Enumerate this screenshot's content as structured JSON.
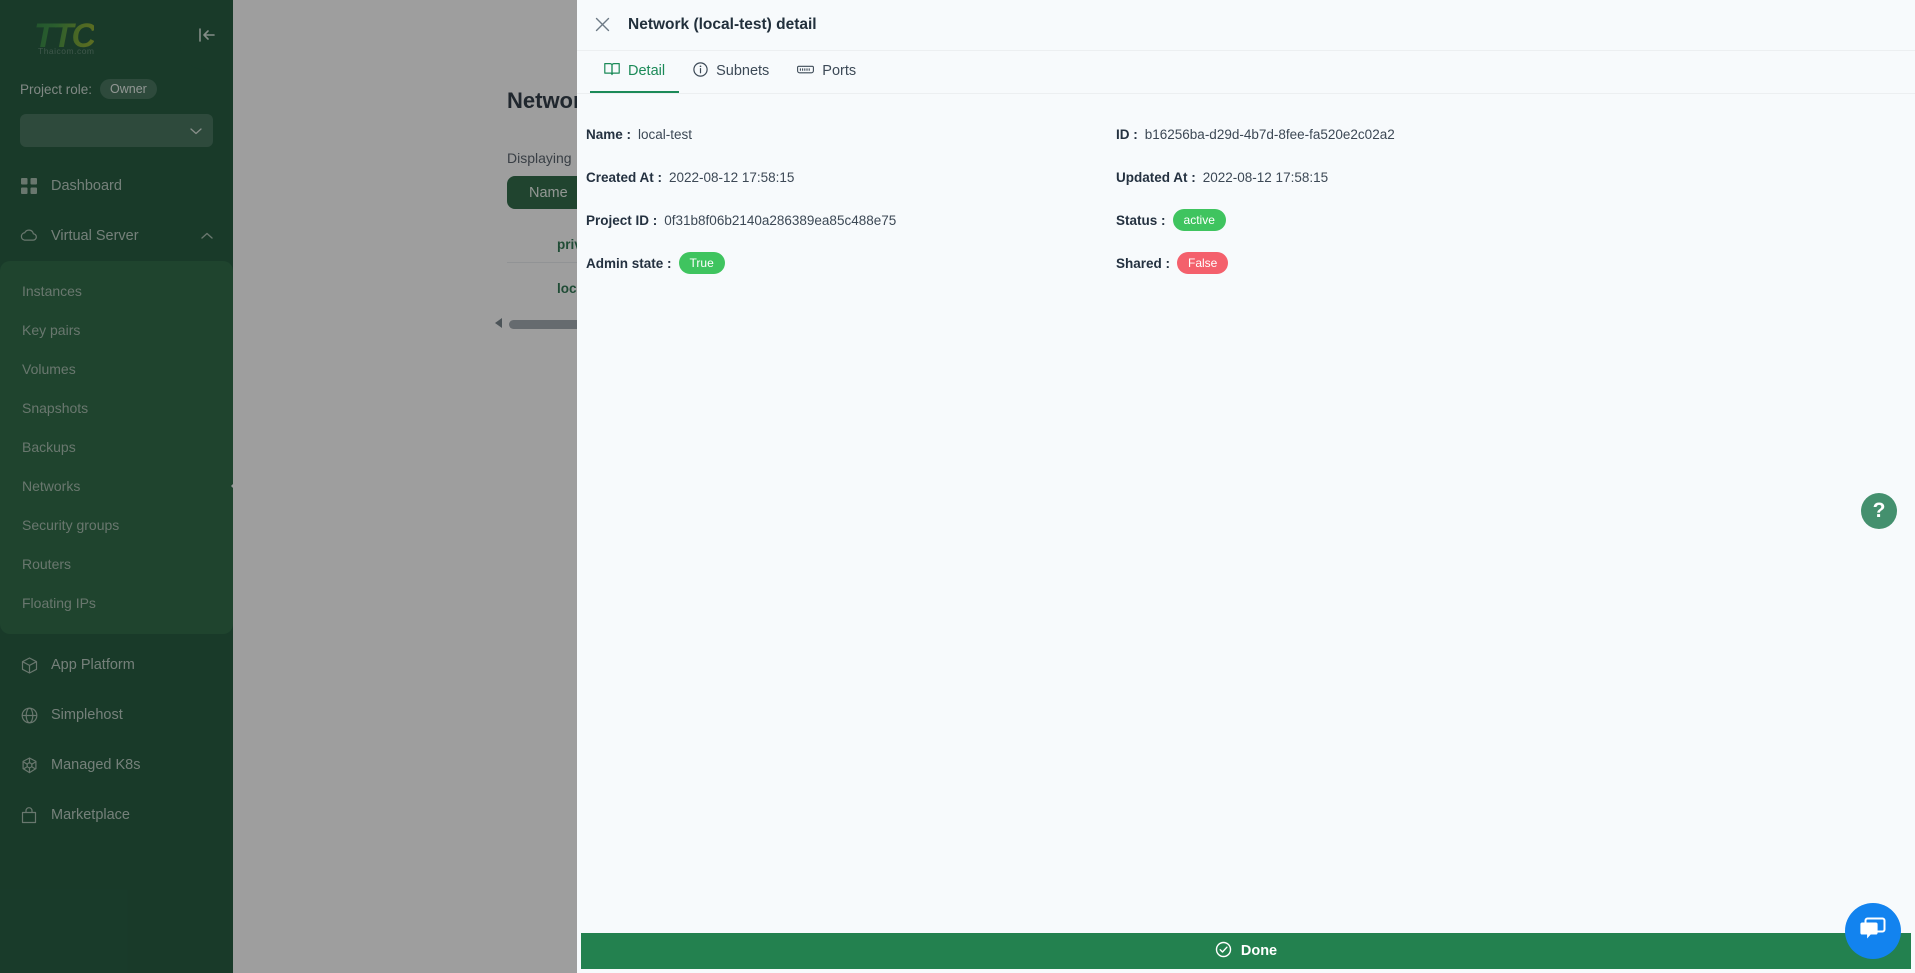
{
  "sidebar": {
    "logo_text": "TTC",
    "logo_subtext": "Thaicom.com",
    "collapse_icon": "collapse-left-icon",
    "project_role_label": "Project role:",
    "project_role_value": "Owner",
    "project_select_value": "",
    "dashboard": {
      "label": "Dashboard",
      "icon": "grid-icon"
    },
    "group": {
      "label": "Virtual Server",
      "icon": "cloud-icon",
      "caret": "chevron-up-icon",
      "items": [
        {
          "label": "Instances",
          "active": false
        },
        {
          "label": "Key pairs",
          "active": false
        },
        {
          "label": "Volumes",
          "active": false
        },
        {
          "label": "Snapshots",
          "active": false
        },
        {
          "label": "Backups",
          "active": false
        },
        {
          "label": "Networks",
          "active": true
        },
        {
          "label": "Security groups",
          "active": false
        },
        {
          "label": "Routers",
          "active": false
        },
        {
          "label": "Floating IPs",
          "active": false
        }
      ]
    },
    "bottom_items": [
      {
        "label": "App Platform",
        "icon": "cube-icon"
      },
      {
        "label": "Simplehost",
        "icon": "globe-icon"
      },
      {
        "label": "Managed K8s",
        "icon": "kubernetes-icon"
      },
      {
        "label": "Marketplace",
        "icon": "bag-icon"
      }
    ]
  },
  "page": {
    "title": "Networks",
    "displaying": "Displaying",
    "table_header": "Name",
    "rows": [
      {
        "name": "private-net"
      },
      {
        "name": "local-test"
      }
    ]
  },
  "modal": {
    "close_icon": "close-icon",
    "title": "Network (local-test) detail",
    "tabs": [
      {
        "label": "Detail",
        "icon": "book-icon",
        "active": true
      },
      {
        "label": "Subnets",
        "icon": "info-circle-icon",
        "active": false
      },
      {
        "label": "Ports",
        "icon": "port-icon",
        "active": false
      }
    ],
    "fields": {
      "name_key": "Name :",
      "name_value": "local-test",
      "id_key": "ID :",
      "id_value": "b16256ba-d29d-4b7d-8fee-fa520e2c02a2",
      "created_key": "Created At :",
      "created_value": "2022-08-12 17:58:15",
      "updated_key": "Updated At :",
      "updated_value": "2022-08-12 17:58:15",
      "project_key": "Project ID :",
      "project_value": "0f31b8f06b2140a286389ea85c488e75",
      "status_key": "Status :",
      "status_value": "active",
      "admin_key": "Admin state :",
      "admin_value": "True",
      "shared_key": "Shared :",
      "shared_value": "False"
    },
    "done_label": "Done",
    "done_icon": "check-circle-icon"
  },
  "floating": {
    "help_label": "?",
    "help_icon": "question-mark-icon",
    "chat_icon": "chat-bubbles-icon"
  },
  "colors": {
    "sidebar_bg": "#0d4a2b",
    "sidebar_sub_bg": "#185c34",
    "accent_green": "#1b8a58",
    "done_green": "#23814f",
    "status_green": "#3fc45f",
    "status_red": "#f4606c",
    "chat_blue": "#1283ef",
    "modal_bg": "#f7fafc"
  }
}
